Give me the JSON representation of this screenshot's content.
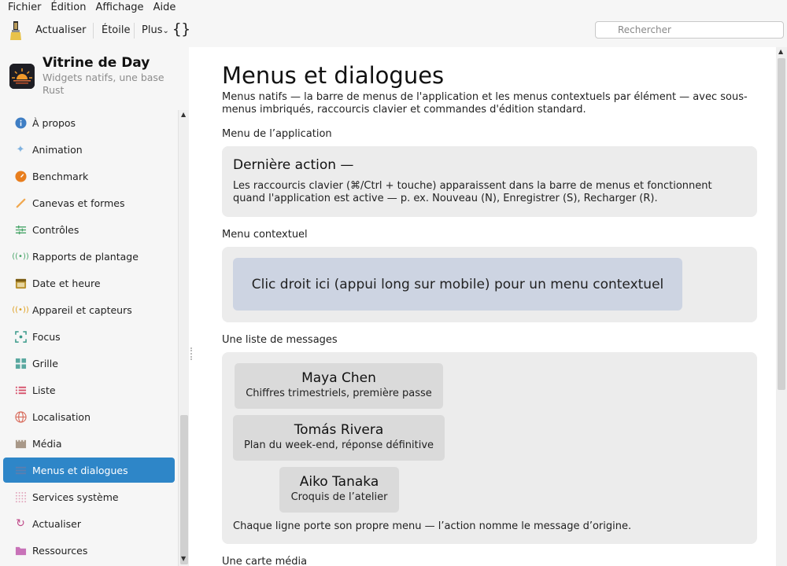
{
  "menubar": [
    "Fichier",
    "Édition",
    "Affichage",
    "Aide"
  ],
  "toolbar": {
    "refresh_label": "Actualiser",
    "star_label": "Étoile",
    "more_label": "Plus",
    "more_chevron": "⌄",
    "braces": "{}",
    "search_placeholder": "Rechercher"
  },
  "app": {
    "title": "Vitrine de Day",
    "subtitle": "Widgets natifs, une base Rust"
  },
  "sidebar": {
    "items": [
      {
        "label": "À propos",
        "icon": "info-icon"
      },
      {
        "label": "Animation",
        "icon": "sparkle-icon"
      },
      {
        "label": "Benchmark",
        "icon": "gauge-icon"
      },
      {
        "label": "Canevas et formes",
        "icon": "brush-icon"
      },
      {
        "label": "Contrôles",
        "icon": "sliders-icon"
      },
      {
        "label": "Rapports de plantage",
        "icon": "broadcast-icon"
      },
      {
        "label": "Date et heure",
        "icon": "calendar-icon"
      },
      {
        "label": "Appareil et capteurs",
        "icon": "sensor-icon"
      },
      {
        "label": "Focus",
        "icon": "focus-icon"
      },
      {
        "label": "Grille",
        "icon": "grid-icon"
      },
      {
        "label": "Liste",
        "icon": "list-icon"
      },
      {
        "label": "Localisation",
        "icon": "globe-icon"
      },
      {
        "label": "Média",
        "icon": "media-icon"
      },
      {
        "label": "Menus et dialogues",
        "icon": "menu-icon"
      },
      {
        "label": "Services système",
        "icon": "dots-grid-icon"
      },
      {
        "label": "Actualiser",
        "icon": "refresh-icon"
      },
      {
        "label": "Ressources",
        "icon": "folder-icon"
      }
    ],
    "active_index": 13
  },
  "main": {
    "title": "Menus et dialogues",
    "description": "Menus natifs — la barre de menus de l'application et les menus contextuels par élément — avec sous-menus imbriqués, raccourcis clavier et commandes d'édition standard.",
    "app_menu": {
      "label": "Menu de l’application",
      "last_action": "Dernière action  —",
      "text": "Les raccourcis clavier (⌘/Ctrl + touche) apparaissent dans la barre de menus et fonctionnent quand l'application est active — p. ex. Nouveau (N), Enregistrer (S), Recharger (R)."
    },
    "context_menu": {
      "label": "Menu contextuel",
      "target_text": "Clic droit ici (appui long sur mobile) pour un menu contextuel"
    },
    "messages": {
      "label": "Une liste de messages",
      "items": [
        {
          "name": "Maya Chen",
          "subject": "Chiffres trimestriels, première passe"
        },
        {
          "name": "Tomás Rivera",
          "subject": "Plan du week-end, réponse définitive"
        },
        {
          "name": "Aiko Tanaka",
          "subject": "Croquis de l’atelier"
        }
      ],
      "footer": "Chaque ligne porte son propre menu — l’action nomme le message d’origine."
    },
    "media_card_label": "Une carte média"
  },
  "colors": {
    "accent": "#2e86c8",
    "card": "#ececec",
    "context_target": "#cdd4e2"
  }
}
